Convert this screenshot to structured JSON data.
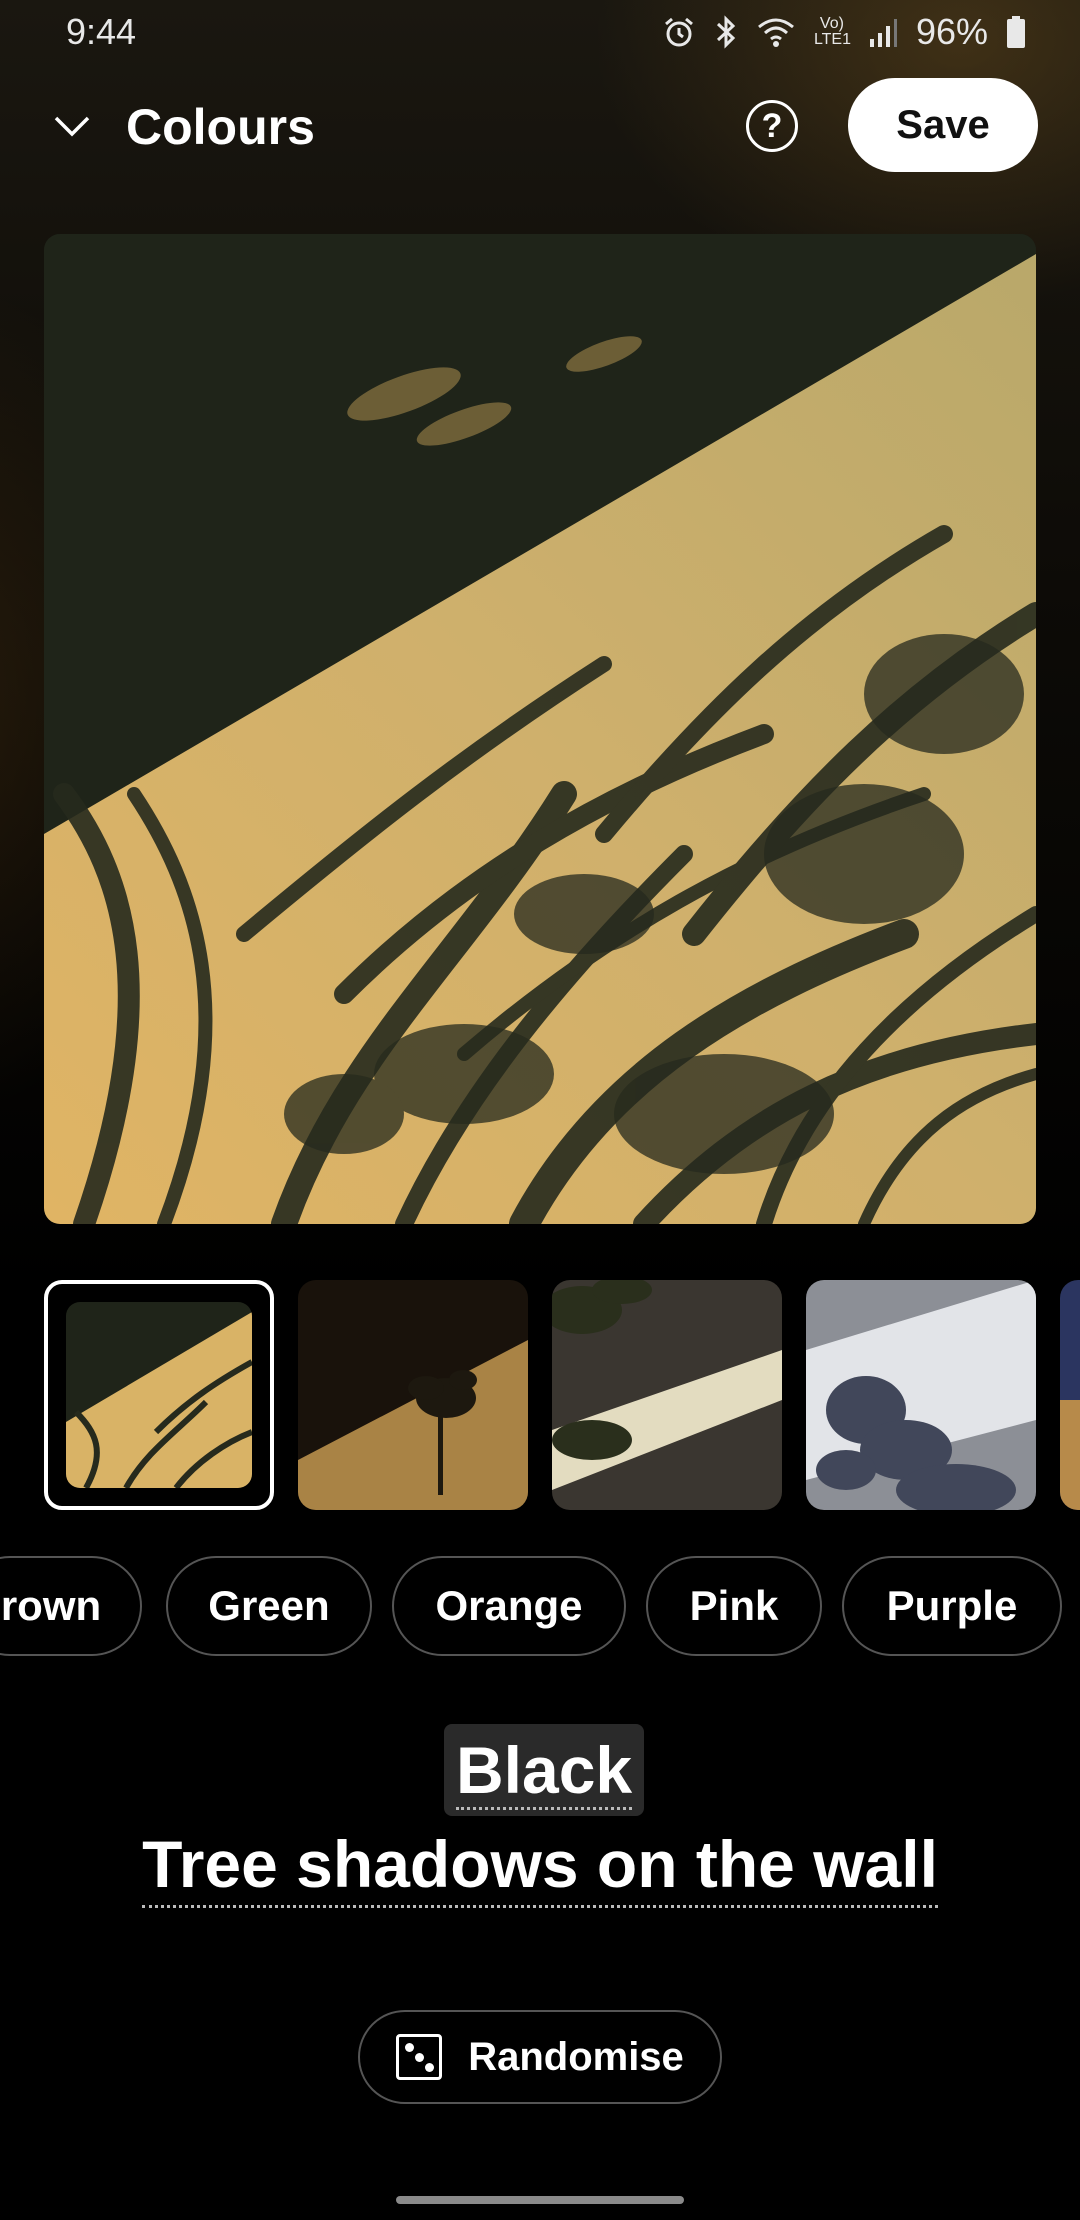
{
  "status_bar": {
    "time": "9:44",
    "network_label": "Vo) LTE1",
    "battery": "96%",
    "icons": [
      "alarm-icon",
      "bluetooth-icon",
      "wifi-icon",
      "signal-icon",
      "battery-icon"
    ]
  },
  "header": {
    "title": "Colours",
    "save_label": "Save",
    "help_label": "?"
  },
  "thumbnails": [
    {
      "id": "tree-shadows-wall",
      "selected": true
    },
    {
      "id": "plant-shadow-warm",
      "selected": false
    },
    {
      "id": "leaves-stripe-light",
      "selected": false
    },
    {
      "id": "leaves-on-white-wall",
      "selected": false
    },
    {
      "id": "dusk-partial",
      "selected": false
    }
  ],
  "colour_chips": [
    "rown",
    "Green",
    "Orange",
    "Pink",
    "Purple"
  ],
  "selection": {
    "colour": "Black",
    "subject": "Tree shadows on the wall"
  },
  "actions": {
    "randomise_label": "Randomise"
  },
  "colors": {
    "background": "#000000",
    "wall_light": "#d8b46a",
    "shadow": "#1e2217",
    "save_button_bg": "#ffffff"
  }
}
